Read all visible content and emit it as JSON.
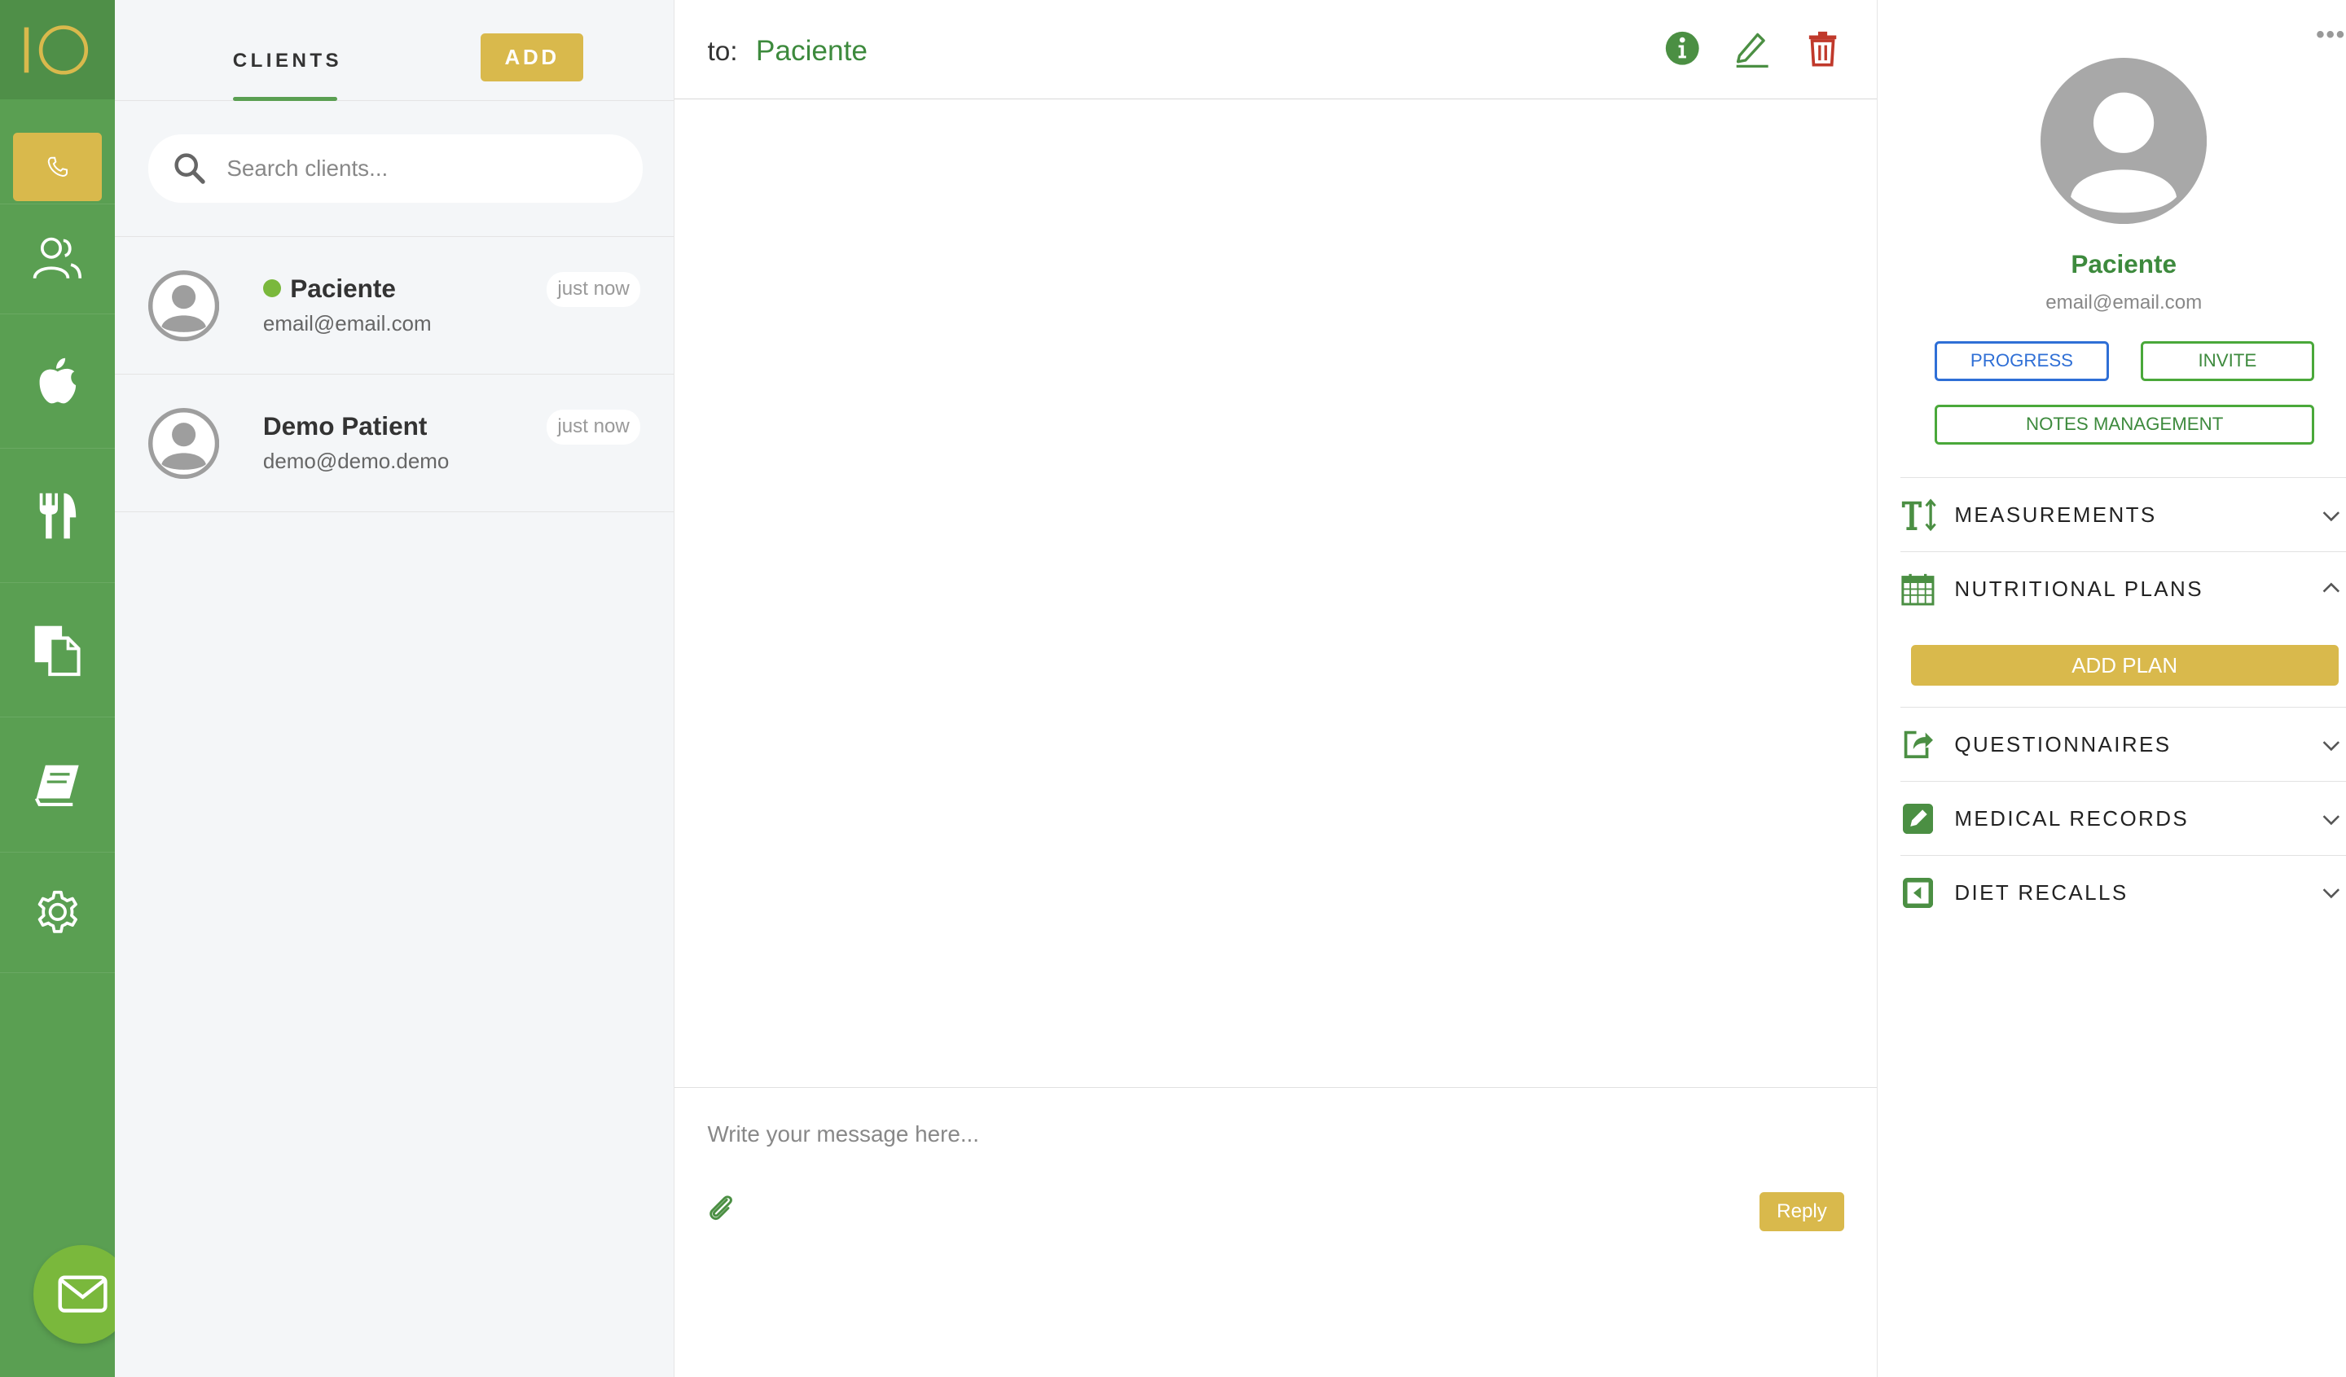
{
  "nav": {
    "logo_text": "IO",
    "items": [
      "profile",
      "phone",
      "clients",
      "nutrition",
      "food",
      "documents",
      "library",
      "settings"
    ],
    "active": "phone",
    "colors": {
      "nav_bg": "#5a9f52",
      "accent": "#d9b94c",
      "fab": "#7ab83c"
    }
  },
  "clients_panel": {
    "tab_label": "CLIENTS",
    "add_label": "ADD",
    "search_placeholder": "Search clients...",
    "clients": [
      {
        "name": "Paciente",
        "email": "email@email.com",
        "time": "just now",
        "online": true
      },
      {
        "name": "Demo Patient",
        "email": "demo@demo.demo",
        "time": "just now",
        "online": false
      }
    ]
  },
  "chat": {
    "to_label": "to:",
    "to_name": "Paciente",
    "message_placeholder": "Write your message here...",
    "reply_label": "Reply"
  },
  "profile": {
    "more_label": "•••",
    "name": "Paciente",
    "email": "email@email.com",
    "progress_label": "PROGRESS",
    "invite_label": "INVITE",
    "notes_label": "NOTES MANAGEMENT",
    "sections": [
      {
        "title": "MEASUREMENTS",
        "expanded": false
      },
      {
        "title": "NUTRITIONAL PLANS",
        "expanded": true
      },
      {
        "title": "QUESTIONNAIRES",
        "expanded": false
      },
      {
        "title": "MEDICAL RECORDS",
        "expanded": false
      },
      {
        "title": "DIET RECALLS",
        "expanded": false
      }
    ],
    "add_plan_label": "ADD PLAN"
  }
}
